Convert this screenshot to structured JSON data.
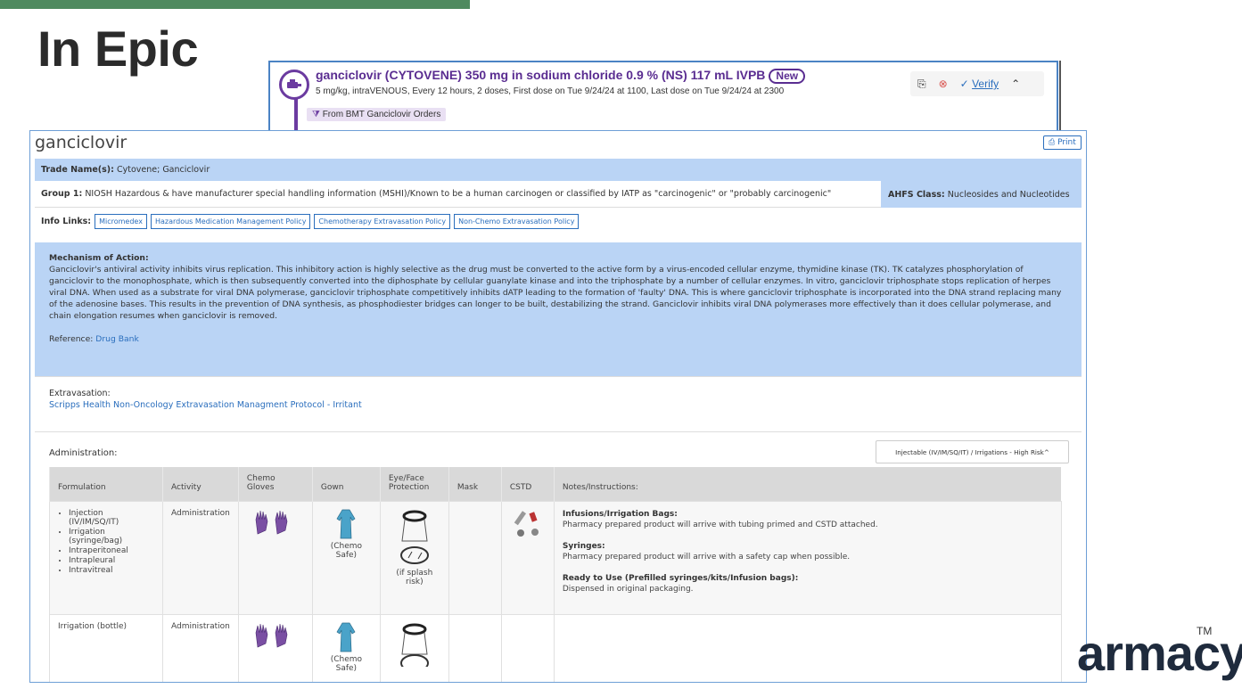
{
  "slide": {
    "title": "In Epic",
    "brand": "armacy",
    "tm": "TM"
  },
  "order": {
    "title": "ganciclovir (CYTOVENE) 350 mg in sodium chloride 0.9 % (NS) 117 mL IVPB",
    "badge": "New",
    "subtitle": "5 mg/kg, intraVENOUS, Every 12 hours, 2 doses, First dose on Tue 9/24/24 at 1100, Last dose on Tue 9/24/24 at 2300",
    "verify_label": "Verify",
    "from_label": "From BMT Ganciclovir Orders"
  },
  "panel": {
    "drug_name": "ganciclovir",
    "print_label": "Print",
    "trade_label": "Trade Name(s):",
    "trade_value": "Cytovene; Ganciclovir",
    "group_label": "Group 1:",
    "group_value": "NIOSH Hazardous & have manufacturer special handling information (MSHI)/Known to be a human carcinogen or classified by IATP as \"carcinogenic\" or \"probably carcinogenic\"",
    "ahfs_label": "AHFS Class:",
    "ahfs_value": "Nucleosides and Nucleotides",
    "info_label": "Info Links:",
    "links": [
      "Micromedex",
      "Hazardous Medication Management Policy",
      "Chemotherapy Extravasation Policy",
      "Non-Chemo Extravasation Policy"
    ],
    "moa_head": "Mechanism of Action:",
    "moa_text": "Ganciclovir's antiviral activity inhibits virus replication. This inhibitory action is highly selective as the drug must be converted to the active form by a virus-encoded cellular enzyme, thymidine kinase (TK). TK catalyzes phosphorylation of ganciclovir to the monophosphate, which is then subsequently converted into the diphosphate by cellular guanylate kinase and into the triphosphate by a number of cellular enzymes. In vitro, ganciclovir triphosphate stops replication of herpes viral DNA. When used as a substrate for viral DNA polymerase, ganciclovir triphosphate competitively inhibits dATP leading to the formation of 'faulty' DNA. This is where ganciclovir triphosphate is incorporated into the DNA strand replacing many of the adenosine bases. This results in the prevention of DNA synthesis, as phosphodiester bridges can longer to be built, destabilizing the strand. Ganciclovir inhibits viral DNA polymerases more effectively than it does cellular polymerase, and chain elongation resumes when ganciclovir is removed.",
    "ref_label": "Reference:",
    "ref_link": "Drug Bank",
    "extrav_head": "Extravasation:",
    "extrav_link": "Scripps Health Non-Oncology Extravasation Managment Protocol - Irritant",
    "admin_label": "Administration:",
    "admin_select": "Injectable (IV/IM/SQ/IT) / Irrigations - High Risk^"
  },
  "table": {
    "headers": [
      "Formulation",
      "Activity",
      "Chemo Gloves",
      "Gown",
      "Eye/Face Protection",
      "Mask",
      "CSTD",
      "Notes/Instructions:"
    ],
    "rows": [
      {
        "formulations": [
          "Injection (IV/IM/SQ/IT)",
          "Irrigation (syringe/bag)",
          "Intraperitoneal",
          "Intrapleural",
          "Intravitreal"
        ],
        "activity": "Administration",
        "gown_note": "(Chemo Safe)",
        "eye_note": "(if splash risk)",
        "notes": [
          {
            "head": "Infusions/Irrigation Bags:",
            "text": "Pharmacy prepared product will arrive with tubing primed and CSTD attached."
          },
          {
            "head": "Syringes:",
            "text": "Pharmacy prepared product will arrive with a safety cap when possible."
          },
          {
            "head": "Ready to Use (Prefilled syringes/kits/Infusion bags):",
            "text": "Dispensed in original packaging."
          }
        ]
      },
      {
        "formulation": "Irrigation (bottle)",
        "activity": "Administration",
        "gown_note": "(Chemo Safe)"
      }
    ]
  }
}
